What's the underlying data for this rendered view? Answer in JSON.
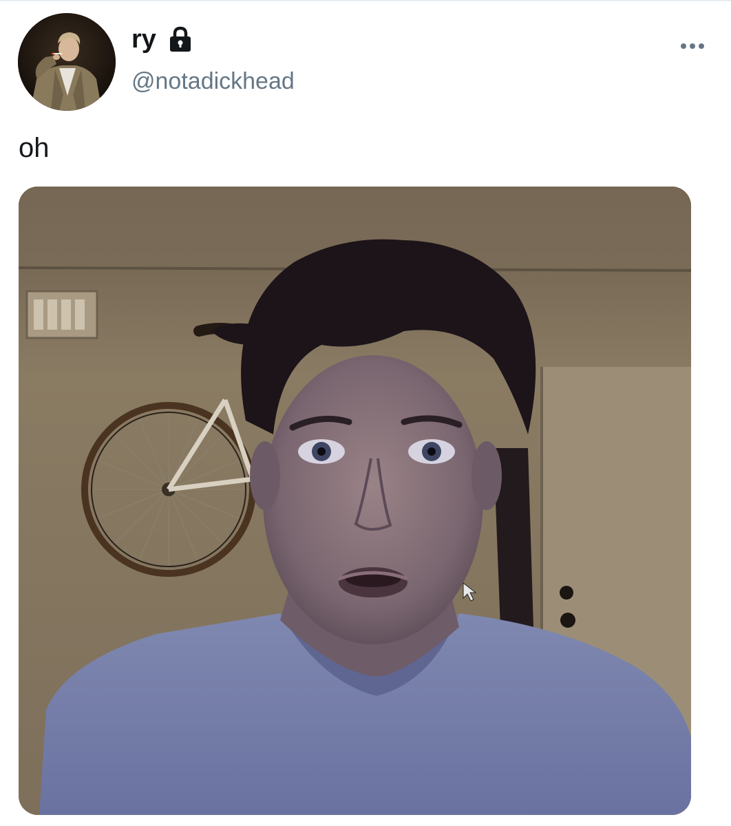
{
  "tweet": {
    "author": {
      "display_name": "ry",
      "handle": "@notadickhead",
      "protected_icon": "lock-icon",
      "avatar": "profile-photo-avatar"
    },
    "menu_icon": "more-options-icon",
    "text": "oh",
    "media": {
      "type": "photo",
      "description_icon": "webcam-photo"
    }
  },
  "colors": {
    "name_text": "#14171a",
    "handle_text": "#657786",
    "border": "#e6ecf0"
  }
}
